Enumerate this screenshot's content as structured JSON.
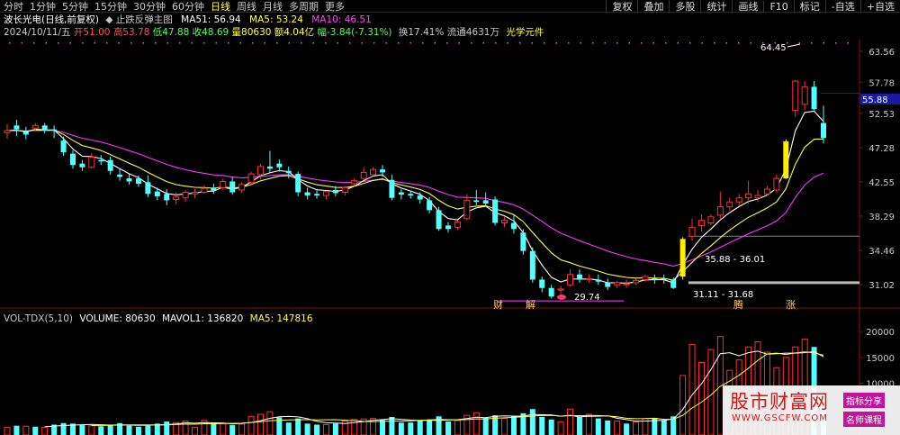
{
  "periods": [
    "分时",
    "1分钟",
    "5分钟",
    "15分钟",
    "30分钟",
    "60分钟",
    "日线",
    "周线",
    "月线",
    "多周期",
    "更多"
  ],
  "active_period": "日线",
  "tools": [
    "复权",
    "叠加",
    "多股",
    "统计",
    "画线",
    "F10",
    "标记",
    "-自选",
    "+自选"
  ],
  "info1": {
    "name": "波长光电(日线,前复权)",
    "indicator": "◆ 止跌反弹主图",
    "ma51": "MA51: 56.94",
    "ma5": "MA5: 53.24",
    "ma10": "MA10: 46.51"
  },
  "info2": {
    "date": "2024/10/11/五",
    "open": "开51.00",
    "high": "高53.78",
    "low": "低47.88",
    "close": "收48.69",
    "volume": "量80630",
    "amount": "额4.04亿",
    "change": "幅-3.84(-7.31%)",
    "turnover": "换17.41%",
    "float": "流通4631万",
    "concept": "光学元件"
  },
  "vol_header": {
    "name": "VOL-TDX(5,10)",
    "volume": "VOLUME: 80630",
    "mavol1": "MAVOL1: 136820",
    "ma5": "MA5: 147816"
  },
  "price_axis": [
    "63.56",
    "57.78",
    "52.53",
    "47.28",
    "42.55",
    "38.29",
    "34.46",
    "31.02"
  ],
  "vol_axis": [
    "20000",
    "15000",
    "10000"
  ],
  "current_price_tag": "55.88",
  "annotations": {
    "high_label": "64.45",
    "low_label": "29.74",
    "range1": "35.88 - 36.01",
    "range2": "31.11 - 31.68",
    "marker_cai": "财",
    "marker_jie": "解",
    "marker_teng": "腾",
    "marker_zhang": "涨"
  },
  "watermark": {
    "title": "股市财富网",
    "url": "WWW.GSCFW.COM",
    "tag1": "指标分享",
    "tag2": "名师课程"
  },
  "colors": {
    "up": "#ff3030",
    "down": "#54ffff",
    "ma_white": "#ffffff",
    "ma_yellow": "#ffff44",
    "ma_purple": "#ff33ff"
  },
  "chart_data": {
    "type": "candlestick",
    "title": "波长光电(日线,前复权)",
    "y_axis_ticks": [
      63.56,
      57.78,
      52.53,
      47.28,
      42.55,
      38.29,
      34.46,
      31.02
    ],
    "candles": [
      [
        49.5,
        50.8,
        49.8,
        48.6
      ],
      [
        50.6,
        51.5,
        50.0,
        49.0
      ],
      [
        49.6,
        50.4,
        49.2,
        48.5
      ],
      [
        50.2,
        51.0,
        50.6,
        49.7
      ],
      [
        50.6,
        51.0,
        49.8,
        49.4
      ],
      [
        50.0,
        50.6,
        49.9,
        48.7
      ],
      [
        48.3,
        48.9,
        46.6,
        46.1
      ],
      [
        46.4,
        46.9,
        44.8,
        44.3
      ],
      [
        45.0,
        45.5,
        44.5,
        44.0
      ],
      [
        44.5,
        46.5,
        45.9,
        44.3
      ],
      [
        45.5,
        46.2,
        45.3,
        44.8
      ],
      [
        45.5,
        46.0,
        44.0,
        43.5
      ],
      [
        43.5,
        44.2,
        43.2,
        42.7
      ],
      [
        43.0,
        43.6,
        42.6,
        42.2
      ],
      [
        43.0,
        43.4,
        42.3,
        41.9
      ],
      [
        42.5,
        43.4,
        41.0,
        40.6
      ],
      [
        41.3,
        41.8,
        40.7,
        40.2
      ],
      [
        41.0,
        41.6,
        40.2,
        39.6
      ],
      [
        40.3,
        41.2,
        40.6,
        39.7
      ],
      [
        40.5,
        41.5,
        41.2,
        40.0
      ],
      [
        41.0,
        41.6,
        41.2,
        40.5
      ],
      [
        41.2,
        42.1,
        41.7,
        41.0
      ],
      [
        41.8,
        42.3,
        41.4,
        41.0
      ],
      [
        41.8,
        43.0,
        42.6,
        41.5
      ],
      [
        42.6,
        43.2,
        41.2,
        40.9
      ],
      [
        41.5,
        42.5,
        42.2,
        41.1
      ],
      [
        42.5,
        43.9,
        43.6,
        42.2
      ],
      [
        43.5,
        45.0,
        44.6,
        42.9
      ],
      [
        44.6,
        46.8,
        44.3,
        43.8
      ],
      [
        45.0,
        45.6,
        44.5,
        43.9
      ],
      [
        44.0,
        44.6,
        43.7,
        43.0
      ],
      [
        43.6,
        43.9,
        41.2,
        40.7
      ],
      [
        41.2,
        41.8,
        40.8,
        40.3
      ],
      [
        41.0,
        41.6,
        40.8,
        40.4
      ],
      [
        40.8,
        41.4,
        41.3,
        40.3
      ],
      [
        41.5,
        42.0,
        41.1,
        40.7
      ],
      [
        41.2,
        42.0,
        41.8,
        40.8
      ],
      [
        42.3,
        43.0,
        42.7,
        42.0
      ],
      [
        43.0,
        44.5,
        43.8,
        42.8
      ],
      [
        43.5,
        44.5,
        44.2,
        43.5
      ],
      [
        44.2,
        44.8,
        43.8,
        43.2
      ],
      [
        42.8,
        43.5,
        40.5,
        40.2
      ],
      [
        41.2,
        41.6,
        40.9,
        40.3
      ],
      [
        41.0,
        41.3,
        40.8,
        40.4
      ],
      [
        40.8,
        41.2,
        40.3,
        39.8
      ],
      [
        40.2,
        40.6,
        39.0,
        38.6
      ],
      [
        39.0,
        39.4,
        36.8,
        36.6
      ],
      [
        37.2,
        37.6,
        36.8,
        36.4
      ],
      [
        37.0,
        37.8,
        37.6,
        36.7
      ],
      [
        38.0,
        41.0,
        40.2,
        37.8
      ],
      [
        40.2,
        41.5,
        40.0,
        39.6
      ],
      [
        40.2,
        41.2,
        39.8,
        39.4
      ],
      [
        40.3,
        40.7,
        37.5,
        37.2
      ],
      [
        37.5,
        38.2,
        37.8,
        37.0
      ],
      [
        37.5,
        38.4,
        36.8,
        36.3
      ],
      [
        36.4,
        36.8,
        34.4,
        34.0
      ],
      [
        34.4,
        34.8,
        31.5,
        31.2
      ],
      [
        31.5,
        31.8,
        30.7,
        30.3
      ],
      [
        30.7,
        31.0,
        29.9,
        29.74
      ],
      [
        30.5,
        30.9,
        30.6,
        30.2
      ],
      [
        31.0,
        32.5,
        32.0,
        30.8
      ],
      [
        32.0,
        32.5,
        31.5,
        31.2
      ],
      [
        31.5,
        32.0,
        31.6,
        31.2
      ],
      [
        31.5,
        32.0,
        31.3,
        31.0
      ],
      [
        31.2,
        31.6,
        30.8,
        30.5
      ],
      [
        31.0,
        31.4,
        31.2,
        30.7
      ],
      [
        31.0,
        31.5,
        31.1,
        30.7
      ],
      [
        31.2,
        31.6,
        31.4,
        31.0
      ],
      [
        31.5,
        32.0,
        31.8,
        31.3
      ],
      [
        31.6,
        32.0,
        31.5,
        31.1
      ],
      [
        31.6,
        32.0,
        31.5,
        31.1
      ],
      [
        31.5,
        31.7,
        30.7,
        30.6
      ],
      [
        31.8,
        35.9,
        35.7,
        31.5
      ],
      [
        36.0,
        38.0,
        37.0,
        35.5
      ],
      [
        37.2,
        38.5,
        37.8,
        36.5
      ],
      [
        37.5,
        38.5,
        38.2,
        37.2
      ],
      [
        38.4,
        41.3,
        39.4,
        38.0
      ],
      [
        39.4,
        40.5,
        40.0,
        39.0
      ],
      [
        40.0,
        41.0,
        40.5,
        39.5
      ],
      [
        40.5,
        42.7,
        41.0,
        39.8
      ],
      [
        40.5,
        41.5,
        40.8,
        40.0
      ],
      [
        41.0,
        42.0,
        41.6,
        40.8
      ],
      [
        41.5,
        43.5,
        43.0,
        41.2
      ],
      [
        43.0,
        48.5,
        48.2,
        42.9
      ],
      [
        53.0,
        58.2,
        58.0,
        52.0
      ],
      [
        54.0,
        58.0,
        57.0,
        53.0
      ],
      [
        57.0,
        58.0,
        53.2,
        53.0
      ],
      [
        51.0,
        53.78,
        48.69,
        47.88
      ]
    ],
    "volumes": [
      [
        1500,
        1
      ],
      [
        1800,
        0
      ],
      [
        1700,
        1
      ],
      [
        1600,
        0
      ],
      [
        1500,
        1
      ],
      [
        2000,
        0
      ],
      [
        2300,
        0
      ],
      [
        2200,
        0
      ],
      [
        1900,
        0
      ],
      [
        1800,
        1
      ],
      [
        1700,
        0
      ],
      [
        2000,
        0
      ],
      [
        2300,
        0
      ],
      [
        1800,
        0
      ],
      [
        1600,
        0
      ],
      [
        1800,
        0
      ],
      [
        2200,
        0
      ],
      [
        2600,
        0
      ],
      [
        2400,
        1
      ],
      [
        2700,
        1
      ],
      [
        1500,
        1
      ],
      [
        2800,
        1
      ],
      [
        2300,
        0
      ],
      [
        2200,
        1
      ],
      [
        1900,
        0
      ],
      [
        2100,
        1
      ],
      [
        3600,
        1
      ],
      [
        4000,
        1
      ],
      [
        4500,
        1
      ],
      [
        3400,
        0
      ],
      [
        2400,
        0
      ],
      [
        3200,
        0
      ],
      [
        2200,
        0
      ],
      [
        2000,
        0
      ],
      [
        2000,
        1
      ],
      [
        2200,
        0
      ],
      [
        2700,
        1
      ],
      [
        3000,
        1
      ],
      [
        3100,
        1
      ],
      [
        3200,
        1
      ],
      [
        2900,
        0
      ],
      [
        3500,
        0
      ],
      [
        2400,
        0
      ],
      [
        2400,
        0
      ],
      [
        2800,
        0
      ],
      [
        3000,
        0
      ],
      [
        3600,
        0
      ],
      [
        2600,
        0
      ],
      [
        2800,
        1
      ],
      [
        3800,
        1
      ],
      [
        4300,
        1
      ],
      [
        3300,
        0
      ],
      [
        3800,
        0
      ],
      [
        3200,
        1
      ],
      [
        3700,
        0
      ],
      [
        4200,
        0
      ],
      [
        5000,
        0
      ],
      [
        3500,
        0
      ],
      [
        3000,
        0
      ],
      [
        2500,
        1
      ],
      [
        5000,
        1
      ],
      [
        3500,
        0
      ],
      [
        4000,
        1
      ],
      [
        3200,
        0
      ],
      [
        2800,
        0
      ],
      [
        2700,
        1
      ],
      [
        2200,
        0
      ],
      [
        2500,
        1
      ],
      [
        3200,
        1
      ],
      [
        3300,
        0
      ],
      [
        2900,
        0
      ],
      [
        3600,
        0
      ],
      [
        11500,
        1
      ],
      [
        17500,
        1
      ],
      [
        14000,
        1
      ],
      [
        16500,
        1
      ],
      [
        19000,
        1
      ],
      [
        12500,
        1
      ],
      [
        14500,
        1
      ],
      [
        17000,
        1
      ],
      [
        18000,
        1
      ],
      [
        16000,
        1
      ],
      [
        13000,
        1
      ],
      [
        15000,
        1
      ],
      [
        17000,
        1
      ],
      [
        18500,
        1
      ],
      [
        17000,
        0
      ],
      [
        8063,
        0
      ]
    ],
    "volume_axis_ticks": [
      20000,
      15000,
      10000
    ]
  }
}
